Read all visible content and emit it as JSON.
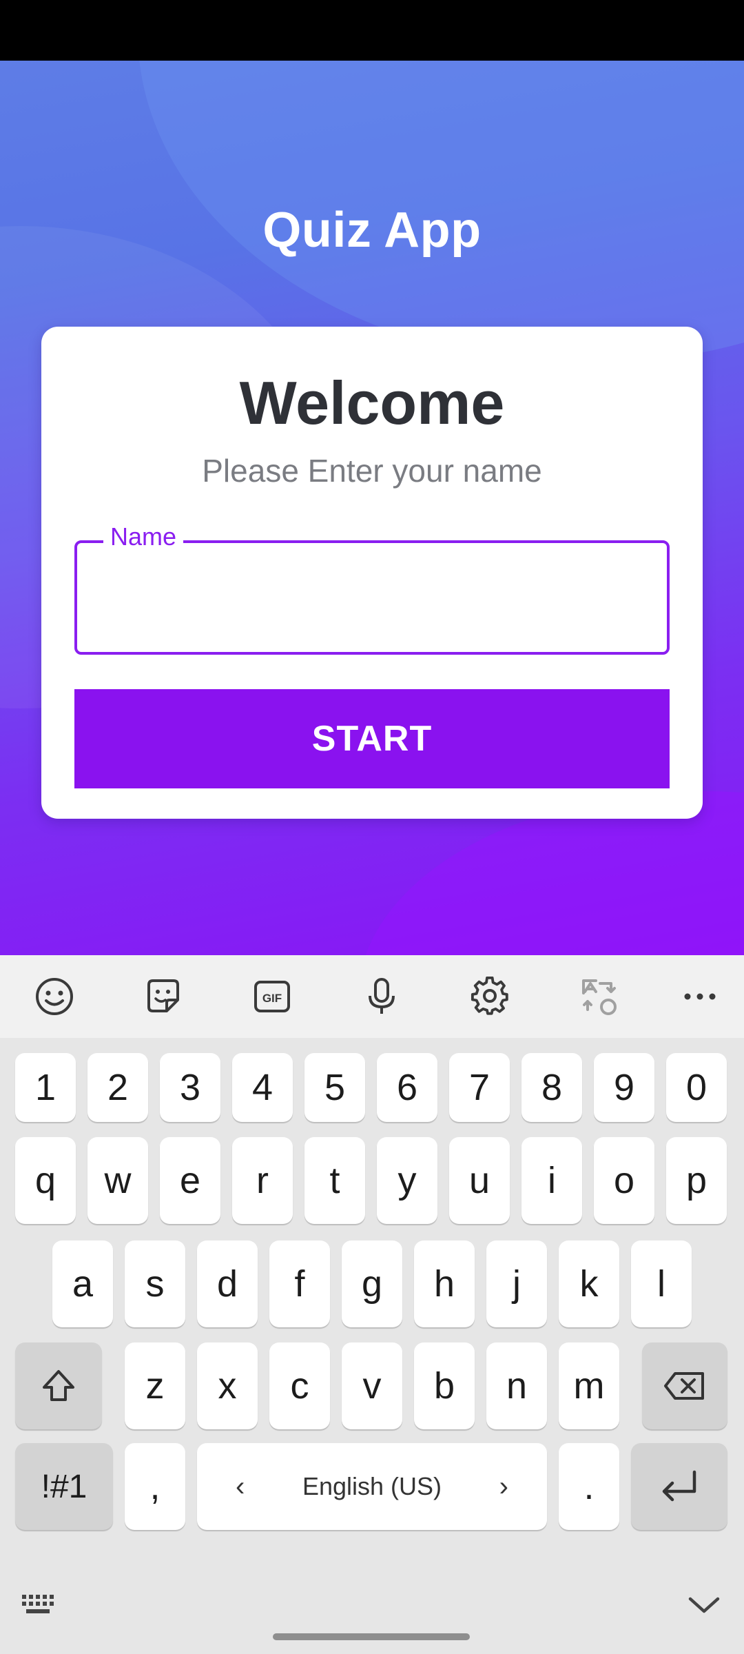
{
  "app": {
    "title": "Quiz App"
  },
  "card": {
    "heading": "Welcome",
    "subtitle": "Please Enter your name",
    "name_label": "Name",
    "name_value": "",
    "start_label": "START"
  },
  "colors": {
    "accent": "#8a12ef",
    "gradient_top": "#5e7de6",
    "gradient_bottom": "#8a14f5"
  },
  "keyboard": {
    "toolbar_icons": [
      "emoji-icon",
      "sticker-icon",
      "gif-icon",
      "microphone-icon",
      "gear-icon",
      "translate-icon",
      "more-icon"
    ],
    "gif_text": "GIF",
    "number_row": [
      "1",
      "2",
      "3",
      "4",
      "5",
      "6",
      "7",
      "8",
      "9",
      "0"
    ],
    "row1": [
      "q",
      "w",
      "e",
      "r",
      "t",
      "y",
      "u",
      "i",
      "o",
      "p"
    ],
    "row2": [
      "a",
      "s",
      "d",
      "f",
      "g",
      "h",
      "j",
      "k",
      "l"
    ],
    "row3": [
      "z",
      "x",
      "c",
      "v",
      "b",
      "n",
      "m"
    ],
    "symbols_label": "!#1",
    "comma": ",",
    "period": ".",
    "space_label": "English (US)",
    "space_left": "‹",
    "space_right": "›"
  }
}
